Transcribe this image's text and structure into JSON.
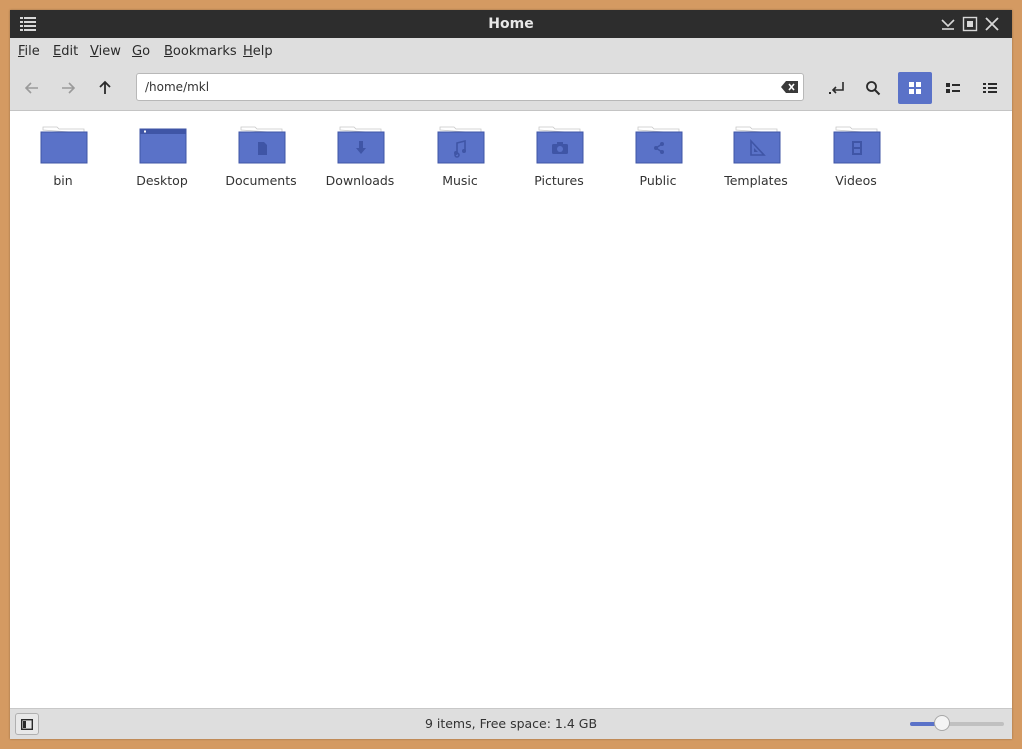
{
  "window": {
    "title": "Home"
  },
  "menubar": {
    "items": [
      {
        "label": "File",
        "mnemonic": "F",
        "rest": "ile"
      },
      {
        "label": "Edit",
        "mnemonic": "E",
        "rest": "dit"
      },
      {
        "label": "View",
        "mnemonic": "V",
        "rest": "iew"
      },
      {
        "label": "Go",
        "mnemonic": "G",
        "rest": "o"
      },
      {
        "label": "Bookmarks",
        "mnemonic": "B",
        "rest": "ookmarks"
      },
      {
        "label": "Help",
        "mnemonic": "H",
        "rest": "elp"
      }
    ]
  },
  "toolbar": {
    "path": "/home/mkl"
  },
  "files": [
    {
      "name": "bin",
      "emblem": "none"
    },
    {
      "name": "Desktop",
      "emblem": "desktop"
    },
    {
      "name": "Documents",
      "emblem": "document"
    },
    {
      "name": "Downloads",
      "emblem": "download"
    },
    {
      "name": "Music",
      "emblem": "music"
    },
    {
      "name": "Pictures",
      "emblem": "camera"
    },
    {
      "name": "Public",
      "emblem": "share"
    },
    {
      "name": "Templates",
      "emblem": "template"
    },
    {
      "name": "Videos",
      "emblem": "film"
    }
  ],
  "statusbar": {
    "text": "9 items, Free space: 1.4 GB",
    "zoom_level": 0.34
  },
  "colors": {
    "folder": "#5a72c8",
    "folder_dark": "#3f55a6",
    "accent": "#5a72c8"
  }
}
